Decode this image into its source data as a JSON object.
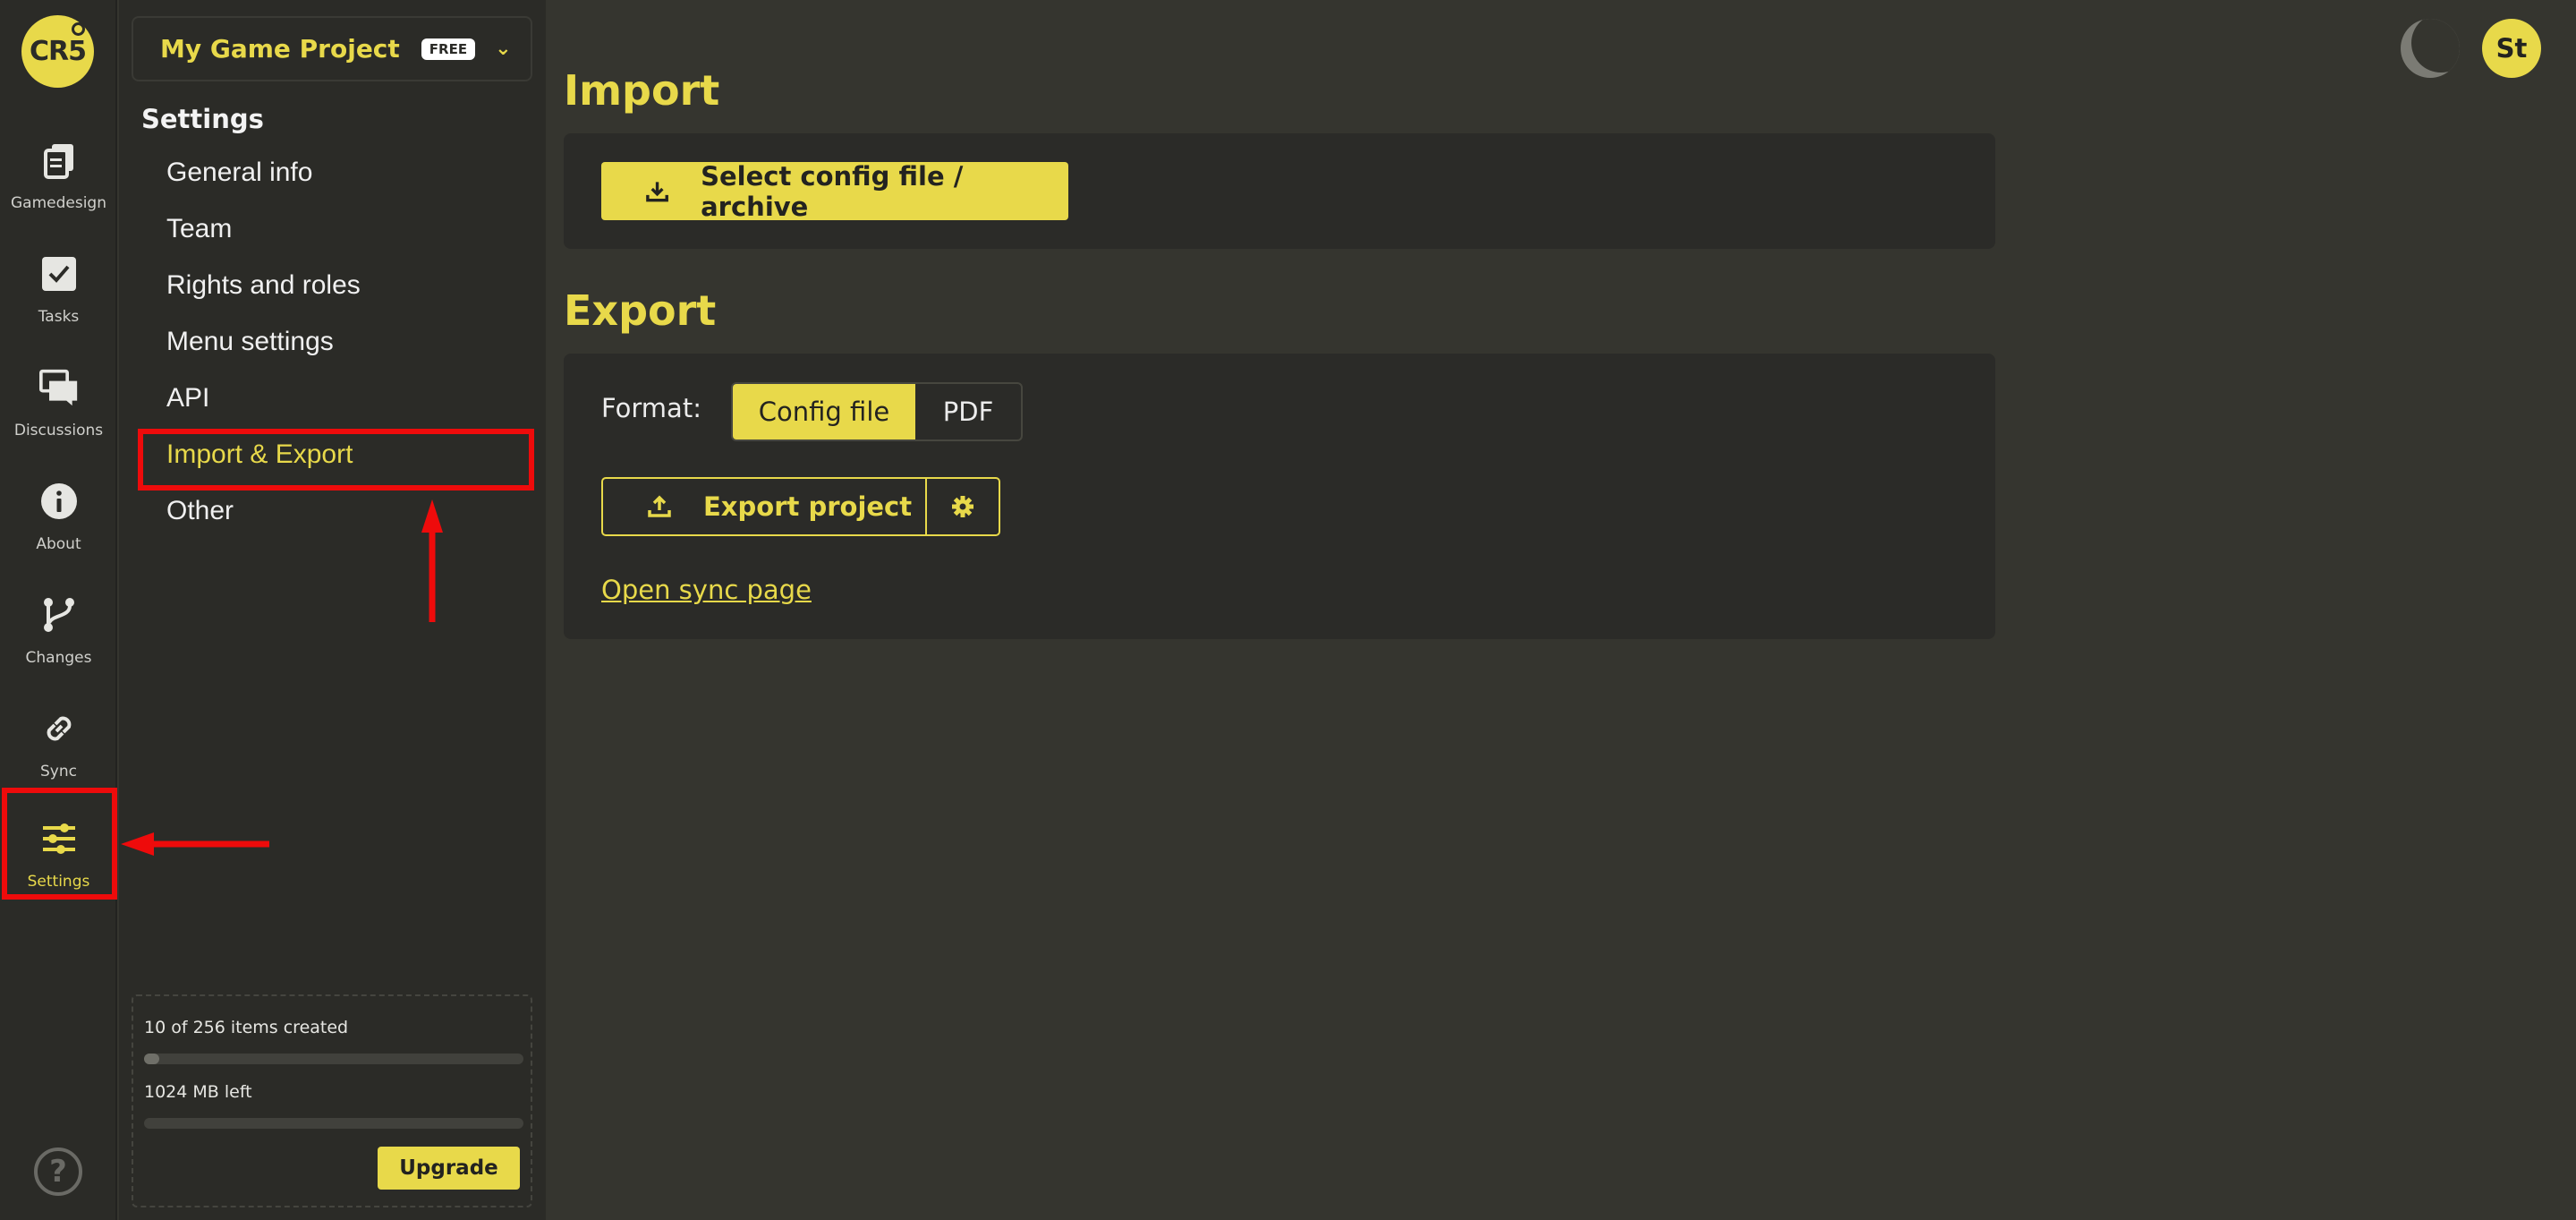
{
  "logo": {
    "text": "CR5"
  },
  "rail": {
    "items": [
      {
        "label": "Gamedesign",
        "icon": "document-stack-icon"
      },
      {
        "label": "Tasks",
        "icon": "checkbox-icon"
      },
      {
        "label": "Discussions",
        "icon": "chat-bubbles-icon"
      },
      {
        "label": "About",
        "icon": "info-icon"
      },
      {
        "label": "Changes",
        "icon": "branch-icon"
      },
      {
        "label": "Sync",
        "icon": "link-icon"
      },
      {
        "label": "Settings",
        "icon": "sliders-icon",
        "active": true
      }
    ],
    "help": "?"
  },
  "project": {
    "name": "My Game Project",
    "badge": "FREE"
  },
  "settings": {
    "heading": "Settings",
    "menu": [
      {
        "label": "General info"
      },
      {
        "label": "Team"
      },
      {
        "label": "Rights and roles"
      },
      {
        "label": "Menu settings"
      },
      {
        "label": "API"
      },
      {
        "label": "Import & Export",
        "active": true
      },
      {
        "label": "Other"
      }
    ]
  },
  "usage": {
    "items_text": "10 of 256 items created",
    "items_fraction": 0.039,
    "storage_text": "1024 MB left",
    "storage_fraction": 0.0,
    "upgrade_label": "Upgrade"
  },
  "import": {
    "title": "Import",
    "select_label": "Select config file / archive"
  },
  "export": {
    "title": "Export",
    "format_label": "Format:",
    "formats": [
      "Config file",
      "PDF"
    ],
    "selected_format": "Config file",
    "export_label": "Export project",
    "sync_link": "Open sync page"
  },
  "user": {
    "initials": "St"
  },
  "colors": {
    "accent": "#e8d94a",
    "annotation": "#ee0b0b",
    "background": "#35352f",
    "panel": "#2b2b27"
  }
}
